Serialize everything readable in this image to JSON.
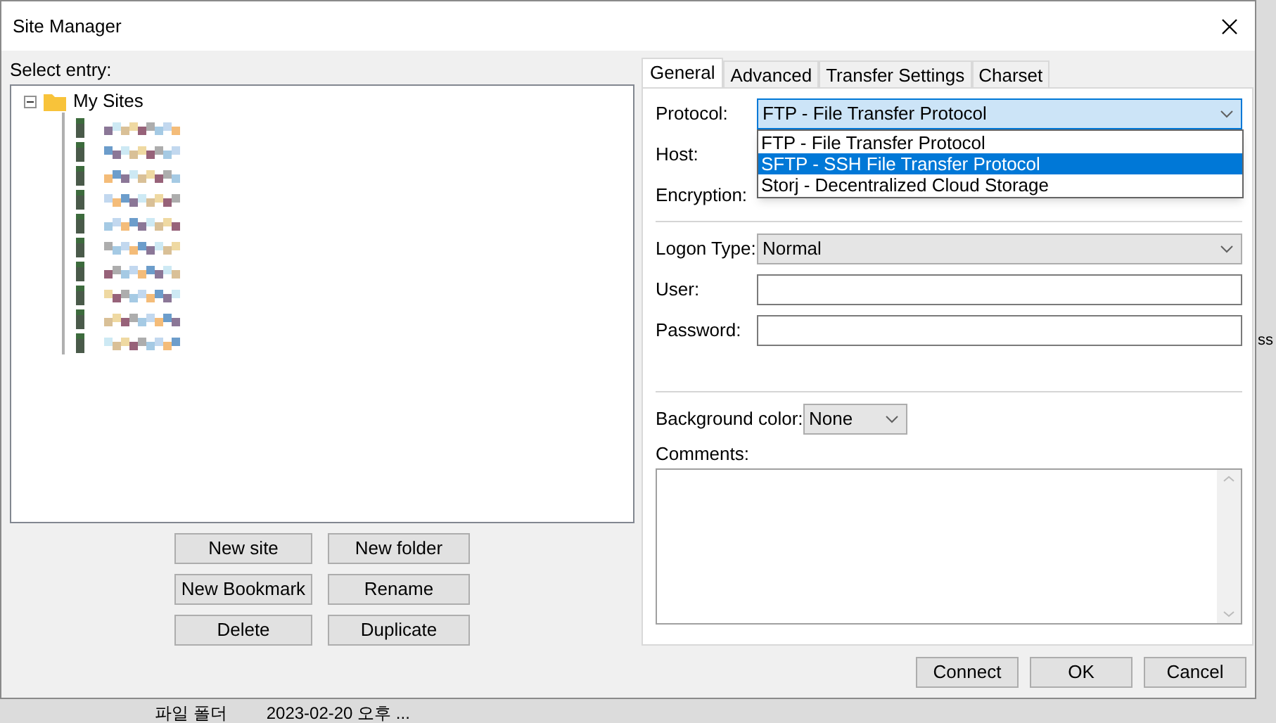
{
  "window": {
    "title": "Site Manager"
  },
  "select_entry": {
    "label": "Select entry:"
  },
  "tree": {
    "label": "My Sites",
    "expanded": true,
    "children": [
      {
        "kind": "redacted"
      },
      {
        "kind": "redacted"
      },
      {
        "kind": "redacted"
      },
      {
        "kind": "redacted"
      },
      {
        "kind": "redacted"
      },
      {
        "kind": "redacted"
      },
      {
        "kind": "redacted"
      },
      {
        "kind": "redacted"
      },
      {
        "kind": "redacted"
      },
      {
        "kind": "redacted"
      }
    ]
  },
  "entry_buttons": [
    {
      "label": "New site"
    },
    {
      "label": "New folder"
    },
    {
      "label": "New Bookmark"
    },
    {
      "label": "Rename"
    },
    {
      "label": "Delete"
    },
    {
      "label": "Duplicate"
    }
  ],
  "tabs": [
    {
      "label": "General",
      "selected": true
    },
    {
      "label": "Advanced",
      "selected": false
    },
    {
      "label": "Transfer Settings",
      "selected": false
    },
    {
      "label": "Charset",
      "selected": false
    }
  ],
  "protocol": {
    "label": "Protocol:",
    "value": "FTP - File Transfer Protocol",
    "expanded": true,
    "options": [
      {
        "label": "FTP - File Transfer Protocol",
        "highlighted": false
      },
      {
        "label": "SFTP - SSH File Transfer Protocol",
        "highlighted": true
      },
      {
        "label": "Storj - Decentralized Cloud Storage",
        "highlighted": false
      }
    ]
  },
  "host": {
    "label": "Host:"
  },
  "encryption": {
    "label": "Encryption:"
  },
  "logon_type": {
    "label": "Logon Type:",
    "value": "Normal"
  },
  "user": {
    "label": "User:"
  },
  "password": {
    "label": "Password:"
  },
  "background_color": {
    "label": "Background color:",
    "value": "None"
  },
  "comments": {
    "label": "Comments:"
  },
  "dialog_buttons": [
    {
      "label": "Connect"
    },
    {
      "label": "OK"
    },
    {
      "label": "Cancel"
    }
  ],
  "behind": {
    "side_text": "ss",
    "cells": [
      "파일 폴더",
      "2023-02-20 오후 ..."
    ]
  }
}
